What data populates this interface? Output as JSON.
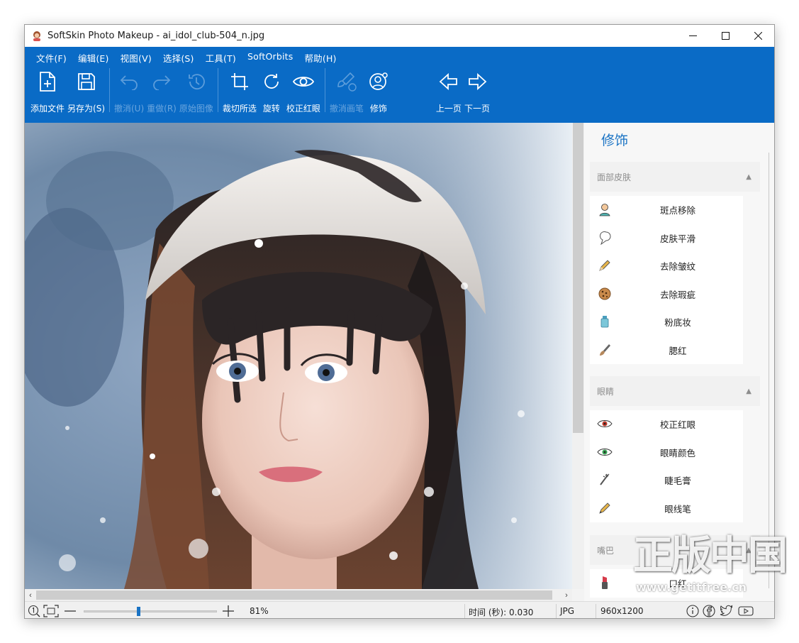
{
  "window": {
    "title": "SoftSkin Photo Makeup - ai_idol_club-504_n.jpg",
    "icons": [
      "app-logo-icon",
      "minimize-icon",
      "maximize-icon",
      "close-icon"
    ]
  },
  "menu": [
    "文件(F)",
    "编辑(E)",
    "视图(V)",
    "选择(S)",
    "工具(T)",
    "SoftOrbits",
    "帮助(H)"
  ],
  "toolbar": [
    {
      "label": "添加文件",
      "icon": "add-file-icon",
      "enabled": true
    },
    {
      "label": "另存为(S)",
      "icon": "save-icon",
      "enabled": true
    },
    {
      "label": "撤消(U)",
      "icon": "undo-icon",
      "enabled": false
    },
    {
      "label": "重做(R)",
      "icon": "redo-icon",
      "enabled": false
    },
    {
      "label": "原始图像",
      "icon": "history-icon",
      "enabled": false
    },
    {
      "label": "裁切所选",
      "icon": "crop-icon",
      "enabled": true
    },
    {
      "label": "旋转",
      "icon": "rotate-icon",
      "enabled": true
    },
    {
      "label": "校正红眼",
      "icon": "eye-icon",
      "enabled": true
    },
    {
      "label": "撤消画笔",
      "icon": "undo-brush-icon",
      "enabled": false
    },
    {
      "label": "修饰",
      "icon": "retouch-icon",
      "enabled": true
    },
    {
      "label": "上一页",
      "icon": "prev-page-icon",
      "enabled": true
    },
    {
      "label": "下一页",
      "icon": "next-page-icon",
      "enabled": true
    }
  ],
  "panel": {
    "title": "修饰",
    "groups": [
      {
        "name": "面部皮肤",
        "items": [
          {
            "label": "斑点移除",
            "icon": "spot-remove-icon"
          },
          {
            "label": "皮肤平滑",
            "icon": "skin-smooth-icon"
          },
          {
            "label": "去除皱纹",
            "icon": "wrinkle-pencil-icon"
          },
          {
            "label": "去除瑕疵",
            "icon": "blemish-cookie-icon"
          },
          {
            "label": "粉底妆",
            "icon": "foundation-bottle-icon"
          },
          {
            "label": "腮红",
            "icon": "blush-brush-icon"
          }
        ]
      },
      {
        "name": "眼睛",
        "items": [
          {
            "label": "校正红眼",
            "icon": "red-eye-icon"
          },
          {
            "label": "眼睛颜色",
            "icon": "eye-color-icon"
          },
          {
            "label": "睫毛膏",
            "icon": "mascara-icon"
          },
          {
            "label": "眼线笔",
            "icon": "eyeliner-icon"
          }
        ]
      },
      {
        "name": "嘴巴",
        "items": [
          {
            "label": "口红",
            "icon": "lipstick-icon"
          }
        ]
      }
    ]
  },
  "status": {
    "zoom": "81%",
    "zoom_fraction": 0.41,
    "time": "时间 (秒): 0.030",
    "format": "JPG",
    "size": "960x1200"
  },
  "watermark": {
    "text": "正版中国",
    "url": "www.getitfree.cn"
  },
  "colors": {
    "ribbon": "#0a6bc6",
    "accent": "#1a73c4"
  }
}
